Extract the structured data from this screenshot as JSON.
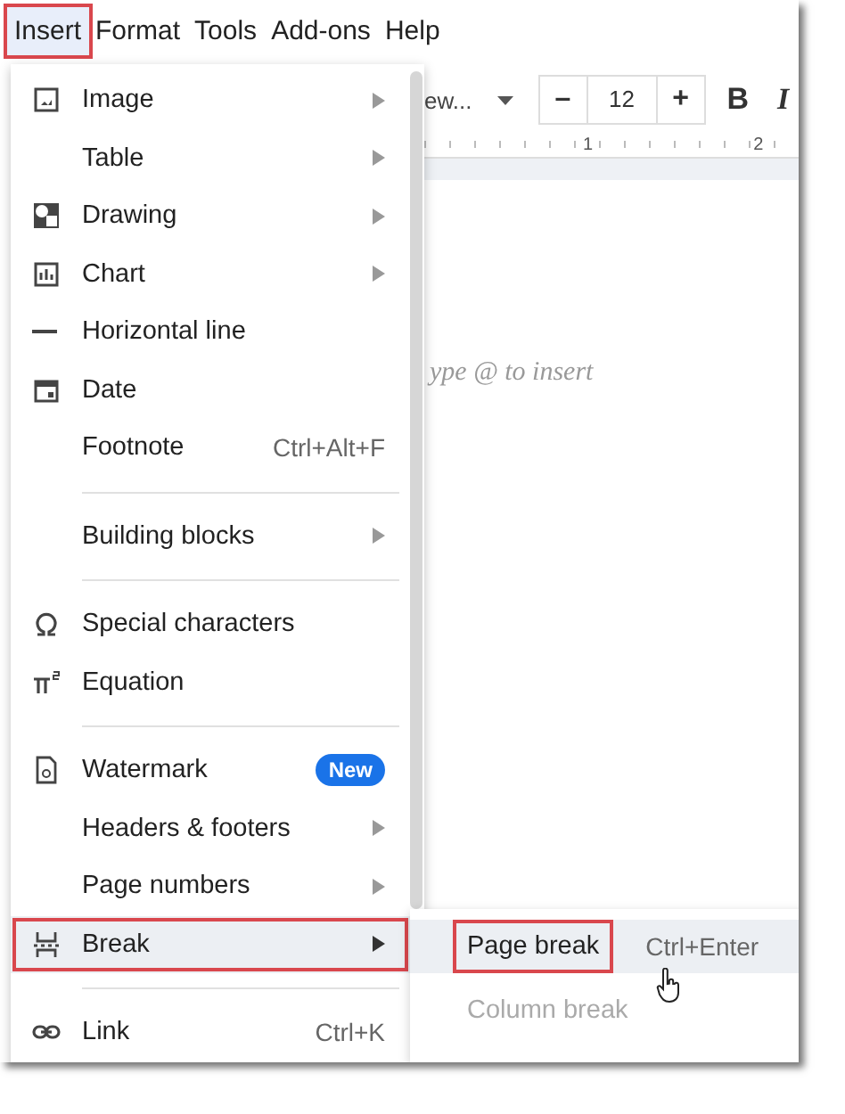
{
  "menubar": [
    {
      "label": "Insert",
      "selected": true
    },
    {
      "label": "Format",
      "selected": false
    },
    {
      "label": "Tools",
      "selected": false
    },
    {
      "label": "Add-ons",
      "selected": false
    },
    {
      "label": "Help",
      "selected": false
    }
  ],
  "toolbar": {
    "font_name": "ew...",
    "decrease": "–",
    "font_size": "12",
    "increase": "+",
    "bold": "B",
    "italic": "I"
  },
  "ruler": [
    "1",
    "2"
  ],
  "document": {
    "placeholder": "ype @ to insert"
  },
  "insert_menu": [
    {
      "kind": "item",
      "label": "Image",
      "submenu": true,
      "selected": false
    },
    {
      "kind": "item",
      "label": "Table",
      "submenu": true,
      "selected": false
    },
    {
      "kind": "item",
      "label": "Drawing",
      "submenu": true,
      "selected": false
    },
    {
      "kind": "item",
      "label": "Chart",
      "submenu": true,
      "selected": false
    },
    {
      "kind": "item",
      "label": "Horizontal line",
      "submenu": false,
      "selected": false
    },
    {
      "kind": "item",
      "label": "Date",
      "submenu": false,
      "selected": false
    },
    {
      "kind": "item",
      "label": "Footnote",
      "shortcut": "Ctrl+Alt+F",
      "submenu": false,
      "selected": false
    },
    {
      "kind": "separator"
    },
    {
      "kind": "item",
      "label": "Building blocks",
      "submenu": true,
      "selected": false
    },
    {
      "kind": "separator"
    },
    {
      "kind": "item",
      "label": "Special characters",
      "submenu": false,
      "selected": false
    },
    {
      "kind": "item",
      "label": "Equation",
      "submenu": false,
      "selected": false
    },
    {
      "kind": "separator"
    },
    {
      "kind": "item",
      "label": "Watermark",
      "badge": "New",
      "submenu": false,
      "selected": false
    },
    {
      "kind": "item",
      "label": "Headers & footers",
      "submenu": true,
      "selected": false
    },
    {
      "kind": "item",
      "label": "Page numbers",
      "submenu": true,
      "selected": false
    },
    {
      "kind": "item",
      "label": "Break",
      "submenu": true,
      "selected": true
    },
    {
      "kind": "separator"
    },
    {
      "kind": "item",
      "label": "Link",
      "shortcut": "Ctrl+K",
      "submenu": false,
      "selected": false
    }
  ],
  "break_submenu": [
    {
      "label": "Page break",
      "shortcut": "Ctrl+Enter",
      "selected": true,
      "disabled": false
    },
    {
      "label": "Column break",
      "selected": false,
      "disabled": true
    }
  ]
}
